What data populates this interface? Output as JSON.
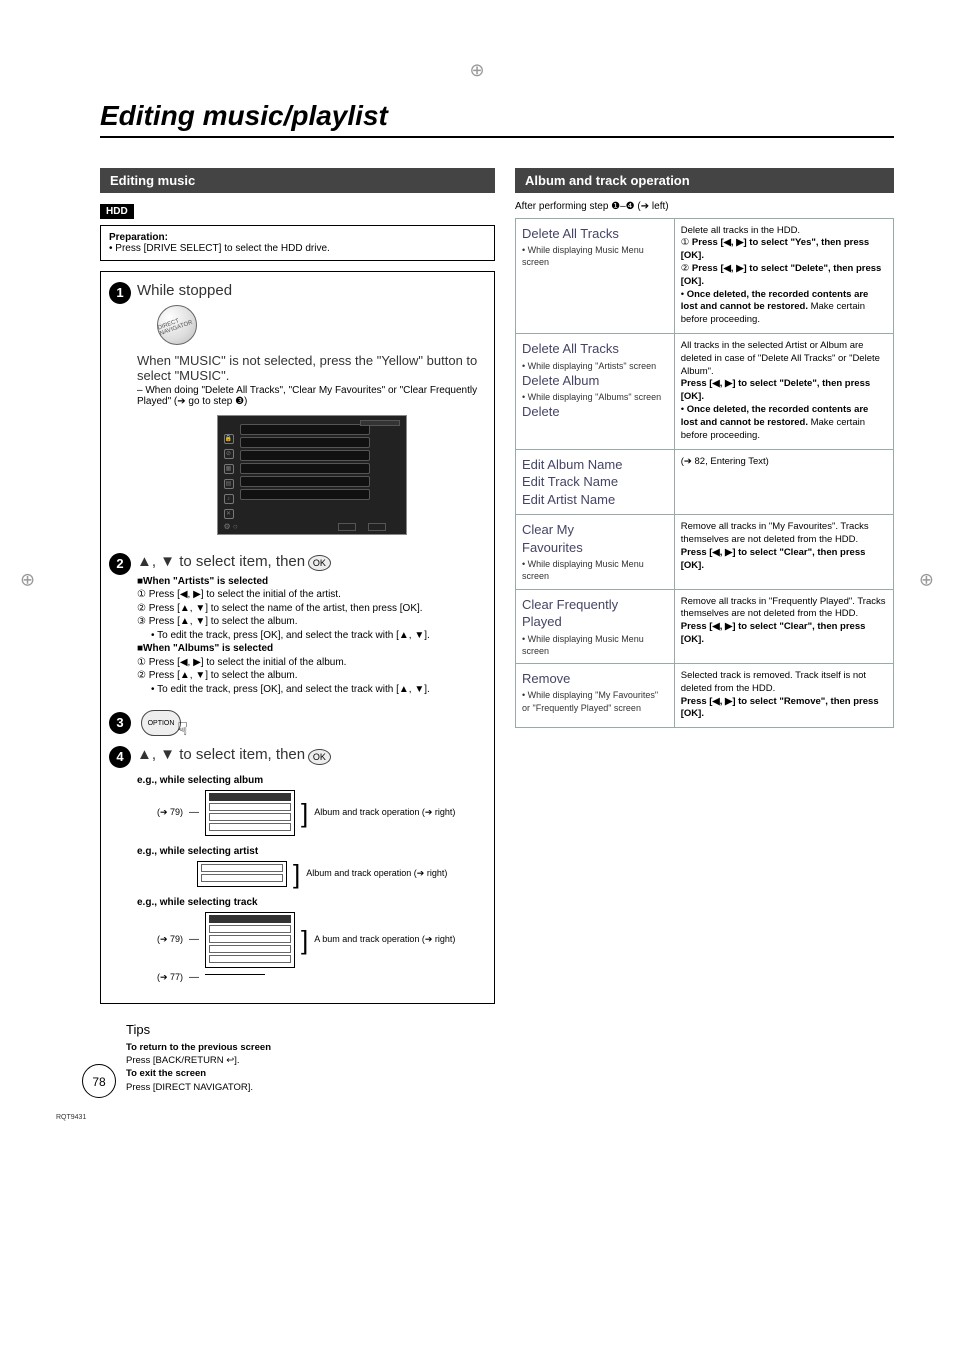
{
  "page_title": "Editing music/playlist",
  "page_number": "78",
  "footer_code": "RQT9431",
  "left": {
    "section_header": "Editing music",
    "hdd_badge": "HDD",
    "preparation_title": "Preparation:",
    "preparation_text": "• Press [DRIVE SELECT] to select the HDD drive.",
    "step1": {
      "heading": "While stopped",
      "navigator_label": "DIRECT NAVIGATOR",
      "body1": "When \"MUSIC\" is not selected, press the \"Yellow\" button to select \"MUSIC\".",
      "body2": "– When doing \"Delete All Tracks\", \"Clear My Favourites\" or \"Clear Frequently Played\" (➔ go to step ❸)"
    },
    "step2": {
      "heading_prefix": "▲, ▼ to select item, then",
      "ok_label": "OK",
      "artists_heading": "■When \"Artists\" is selected",
      "artists_1": "① Press [◀, ▶] to select the initial of the artist.",
      "artists_2": "② Press [▲, ▼] to select the name of the artist, then press [OK].",
      "artists_3": "③ Press [▲, ▼] to select the album.",
      "artists_note": "• To edit the track, press [OK], and select the track with [▲, ▼].",
      "albums_heading": "■When \"Albums\" is selected",
      "albums_1": "① Press [◀, ▶] to select the initial of the album.",
      "albums_2": "② Press [▲, ▼] to select the album.",
      "albums_note": "• To edit the track, press [OK], and select the track with [▲, ▼]."
    },
    "step3": {
      "option_label": "OPTION"
    },
    "step4": {
      "heading_prefix": "▲, ▼ to select item, then",
      "ok_label": "OK",
      "eg_album_title": "e.g., while selecting album",
      "eg_artist_title": "e.g., while selecting artist",
      "eg_track_title": "e.g., while selecting track",
      "xref_79": "(➔ 79)",
      "xref_77": "(➔ 77)",
      "album_op_label": "Album and track operation (➔ right)",
      "abum_op_label": "A bum and track operation (➔ right)"
    },
    "tips": {
      "title": "Tips",
      "return_heading": "To return to the previous screen",
      "return_body": "Press [BACK/RETURN ↩].",
      "exit_heading": "To exit the screen",
      "exit_body": "Press [DIRECT NAVIGATOR]."
    }
  },
  "right": {
    "section_header": "Album and track operation",
    "after_line": "After performing step ❶–❹ (➔ left)",
    "rows": [
      {
        "name": "Delete All Tracks",
        "notes": [
          "While displaying Music Menu screen"
        ],
        "desc": "Delete all tracks in the HDD.\n① Press [◀, ▶] to select \"Yes\", then press [OK].\n② Press [◀, ▶] to select \"Delete\", then press [OK].\n• Once deleted, the recorded contents are lost and cannot be restored. Make certain before proceeding.",
        "desc_bold": [
          "Press [◀, ▶] to select \"Yes\", then press [OK].",
          "Press [◀, ▶] to select \"Delete\", then press [OK].",
          "Once deleted, the recorded contents are lost and cannot be restored."
        ]
      },
      {
        "name_multi": [
          "Delete All Tracks",
          "Delete Album",
          "Delete"
        ],
        "notes": [
          "While displaying \"Artists\" screen",
          "While displaying \"Albums\" screen"
        ],
        "desc": "All tracks in the selected Artist or Album are deleted in case of \"Delete All Tracks\" or \"Delete Album\".\nPress [◀, ▶] to select \"Delete\", then press [OK].\n• Once deleted, the recorded contents are lost and cannot be restored. Make certain before proceeding."
      },
      {
        "name_multi": [
          "Edit Album Name",
          "Edit Track Name",
          "Edit Artist Name"
        ],
        "notes": [],
        "desc": "(➔ 82, Entering Text)"
      },
      {
        "name_multi": [
          "Clear My Favourites"
        ],
        "notes": [
          "While displaying Music Menu screen"
        ],
        "desc": "Remove all tracks in \"My Favourites\". Tracks themselves are not deleted from the HDD.\nPress [◀, ▶] to select \"Clear\", then press [OK]."
      },
      {
        "name_multi": [
          "Clear Frequently Played"
        ],
        "notes": [
          "While displaying Music Menu screen"
        ],
        "desc": "Remove all tracks in \"Frequently Played\". Tracks themselves are not deleted from the HDD.\nPress [◀, ▶] to select \"Clear\", then press [OK]."
      },
      {
        "name": "Remove",
        "notes": [
          "While displaying \"My Favourites\" or \"Frequently Played\" screen"
        ],
        "desc": "Selected track is removed. Track itself is not deleted from the HDD.\nPress [◀, ▶] to select \"Remove\", then press [OK]."
      }
    ]
  }
}
